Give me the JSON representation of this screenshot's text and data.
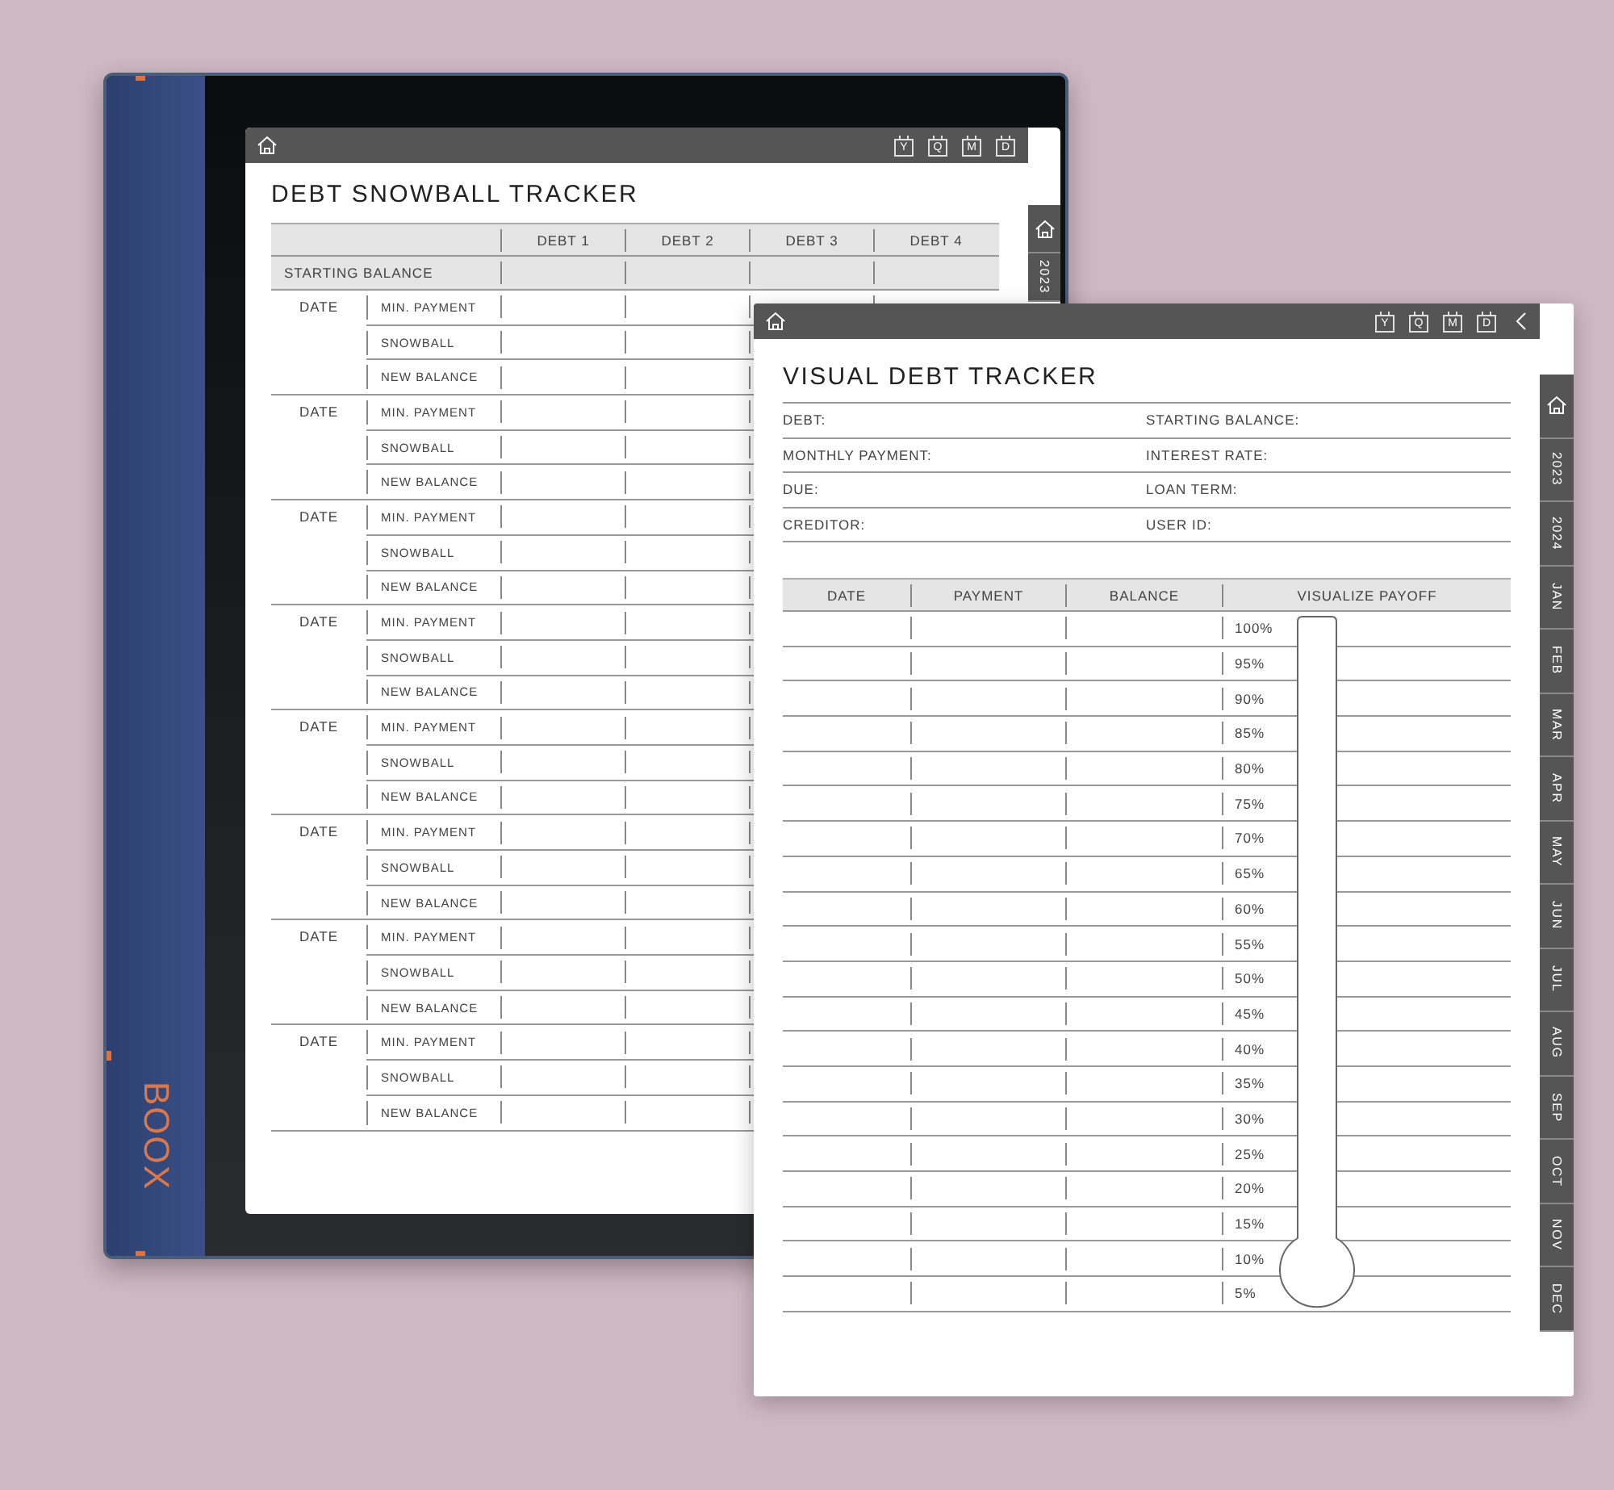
{
  "device": {
    "brand": "BOOX"
  },
  "snowball_tracker": {
    "nav_buttons": [
      "Y",
      "Q",
      "M",
      "D"
    ],
    "side_tabs": [
      "2023"
    ],
    "title": "DEBT SNOWBALL TRACKER",
    "columns": [
      "DEBT 1",
      "DEBT 2",
      "DEBT 3",
      "DEBT 4"
    ],
    "starting_balance_label": "STARTING BALANCE",
    "groups": [
      {
        "date_label": "DATE",
        "rows": [
          "MIN. PAYMENT",
          "SNOWBALL",
          "NEW BALANCE"
        ]
      },
      {
        "date_label": "DATE",
        "rows": [
          "MIN. PAYMENT",
          "SNOWBALL",
          "NEW BALANCE"
        ]
      },
      {
        "date_label": "DATE",
        "rows": [
          "MIN. PAYMENT",
          "SNOWBALL",
          "NEW BALANCE"
        ]
      },
      {
        "date_label": "DATE",
        "rows": [
          "MIN. PAYMENT",
          "SNOWBALL",
          "NEW BALANCE"
        ]
      },
      {
        "date_label": "DATE",
        "rows": [
          "MIN. PAYMENT",
          "SNOWBALL",
          "NEW BALANCE"
        ]
      },
      {
        "date_label": "DATE",
        "rows": [
          "MIN. PAYMENT",
          "SNOWBALL",
          "NEW BALANCE"
        ]
      },
      {
        "date_label": "DATE",
        "rows": [
          "MIN. PAYMENT",
          "SNOWBALL",
          "NEW BALANCE"
        ]
      },
      {
        "date_label": "DATE",
        "rows": [
          "MIN. PAYMENT",
          "SNOWBALL",
          "NEW BALANCE"
        ]
      }
    ]
  },
  "visual_tracker": {
    "nav_buttons": [
      "Y",
      "Q",
      "M",
      "D"
    ],
    "side_tabs": [
      "2023",
      "2024",
      "JAN",
      "FEB",
      "MAR",
      "APR",
      "MAY",
      "JUN",
      "JUL",
      "AUG",
      "SEP",
      "OCT",
      "NOV",
      "DEC"
    ],
    "title": "VISUAL DEBT TRACKER",
    "fields": [
      {
        "left": "DEBT:",
        "right": "STARTING BALANCE:"
      },
      {
        "left": "MONTHLY PAYMENT:",
        "right": "INTEREST RATE:"
      },
      {
        "left": "DUE:",
        "right": "LOAN TERM:"
      },
      {
        "left": "CREDITOR:",
        "right": "USER ID:"
      }
    ],
    "table": {
      "columns": [
        "DATE",
        "PAYMENT",
        "BALANCE",
        "VISUALIZE PAYOFF"
      ],
      "rows": [
        {
          "percent": "100%"
        },
        {
          "percent": "95%"
        },
        {
          "percent": "90%"
        },
        {
          "percent": "85%"
        },
        {
          "percent": "80%"
        },
        {
          "percent": "75%"
        },
        {
          "percent": "70%"
        },
        {
          "percent": "65%"
        },
        {
          "percent": "60%"
        },
        {
          "percent": "55%"
        },
        {
          "percent": "50%"
        },
        {
          "percent": "45%"
        },
        {
          "percent": "40%"
        },
        {
          "percent": "35%"
        },
        {
          "percent": "30%"
        },
        {
          "percent": "25%"
        },
        {
          "percent": "20%"
        },
        {
          "percent": "15%"
        },
        {
          "percent": "10%"
        },
        {
          "percent": "5%"
        }
      ]
    }
  }
}
